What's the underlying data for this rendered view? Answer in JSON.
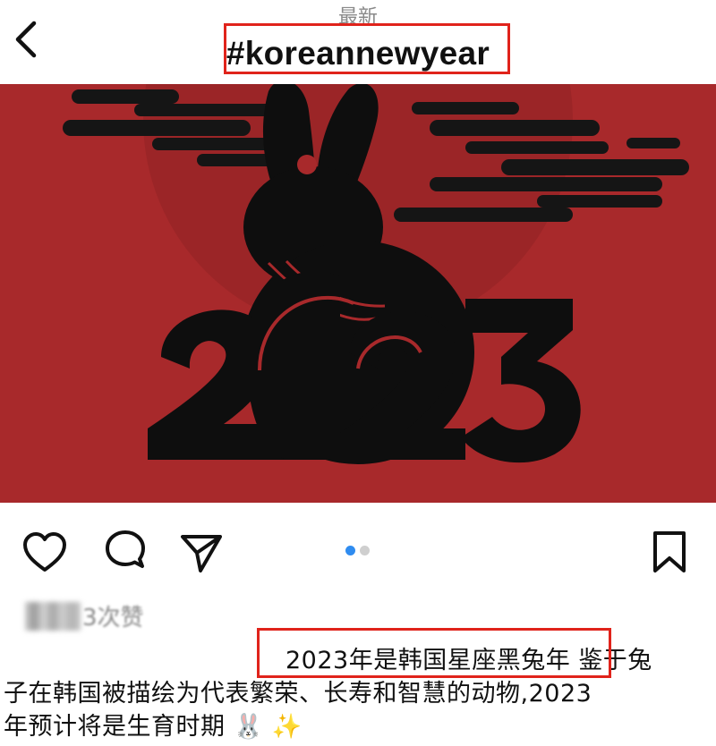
{
  "header": {
    "subtitle": "最新",
    "title": "#koreannewyear"
  },
  "post": {
    "image_text": "2023",
    "carousel": {
      "total": 2,
      "active": 1
    }
  },
  "actions": {
    "like_icon": "heart-icon",
    "comment_icon": "comment-icon",
    "share_icon": "send-icon",
    "save_icon": "bookmark-icon"
  },
  "likes": {
    "text": "3次赞"
  },
  "caption": {
    "line1_highlight": "2023年是韩国星座黑兔年",
    "line1_rest": "鉴于兔",
    "line2": "子在韩国被描绘为代表繁荣、长寿和智慧的动物,2023",
    "line3": "年预计将是生育时期",
    "emoji": "🐰 ✨"
  },
  "colors": {
    "image_bg": "#a8292b",
    "annotation": "#e0231b",
    "dot_active": "#2f8cf0",
    "dot_inactive": "#cfcfcf"
  }
}
